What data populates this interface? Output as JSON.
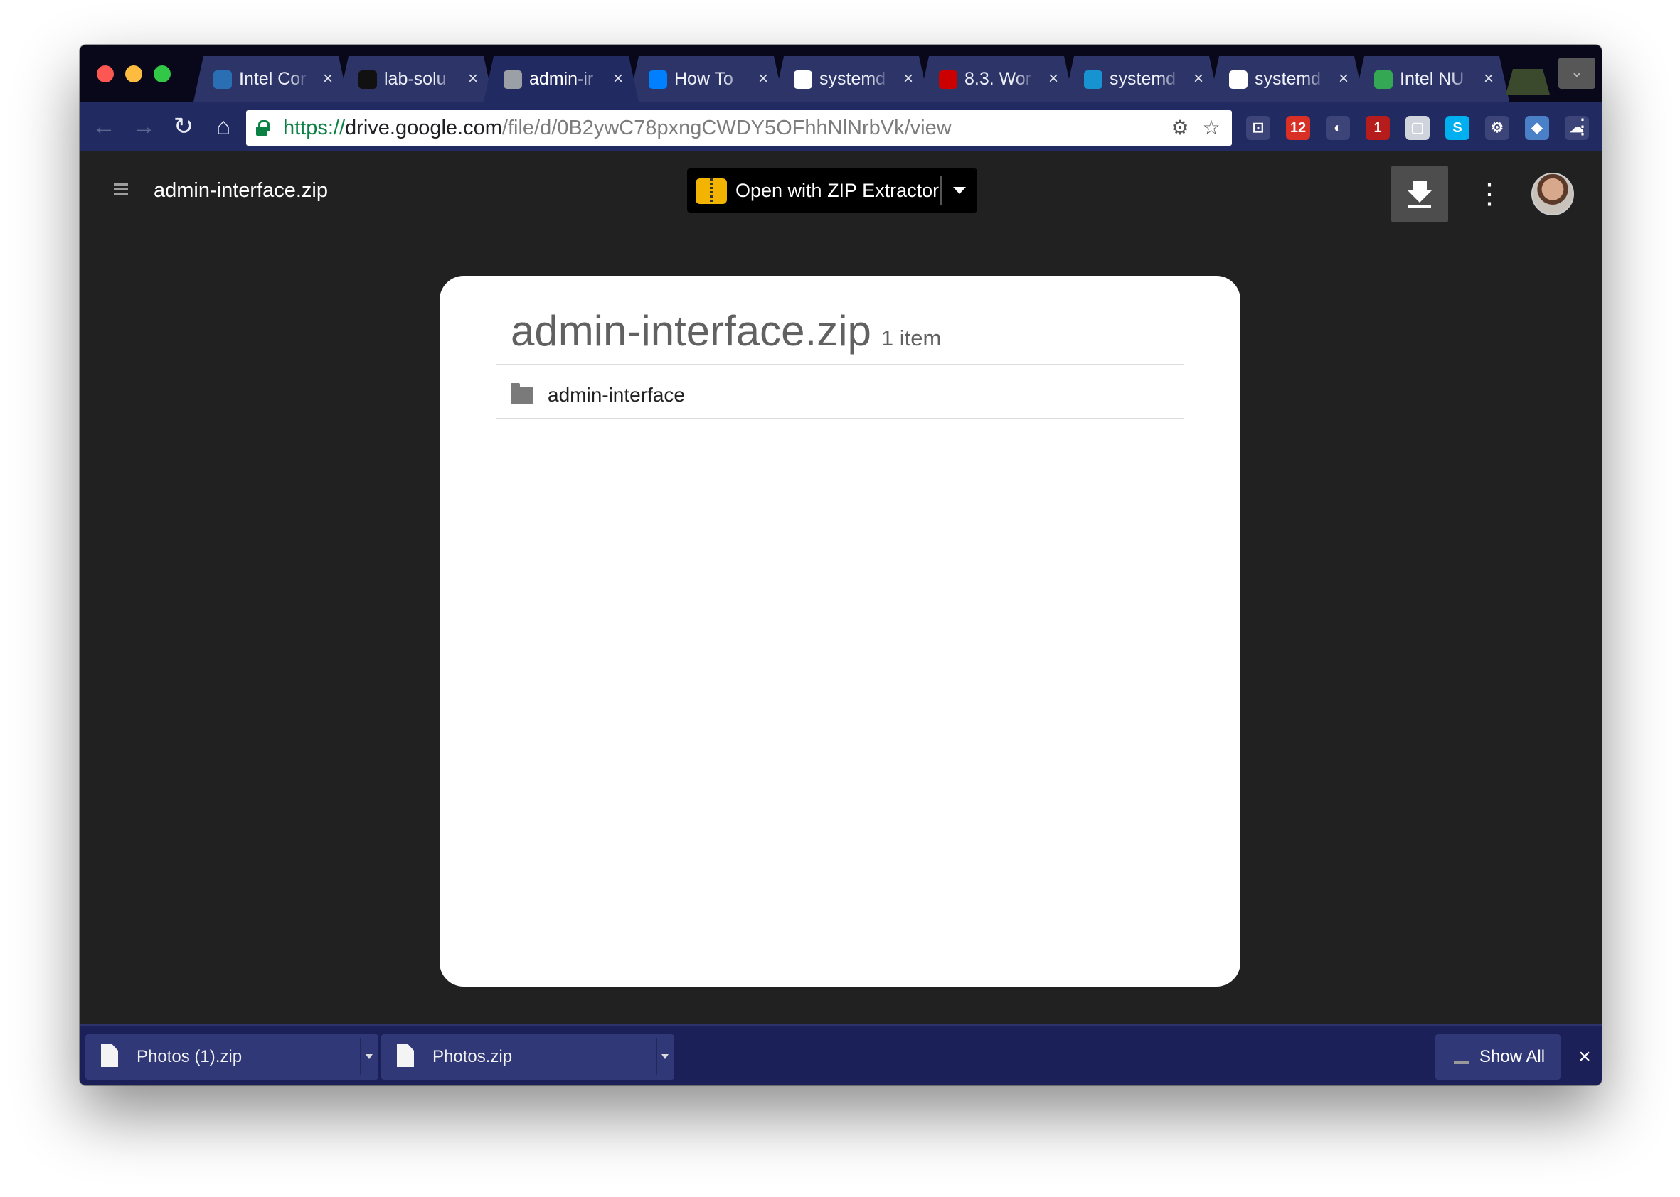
{
  "browser": {
    "tabs": [
      {
        "title": "Intel Cor",
        "close": "×",
        "favicon": "intel-icon",
        "color": "#2a6fb3"
      },
      {
        "title": "lab-solu",
        "close": "×",
        "favicon": "github-icon",
        "color": "#111111"
      },
      {
        "title": "admin-ir",
        "close": "×",
        "favicon": "drive-file-icon",
        "color": "#9aa0a6",
        "active": true
      },
      {
        "title": "How To",
        "close": "×",
        "favicon": "digitalocean-icon",
        "color": "#0080ff"
      },
      {
        "title": "systemd",
        "close": "×",
        "favicon": "google-icon",
        "color": "#ffffff"
      },
      {
        "title": "8.3. Wor",
        "close": "×",
        "favicon": "redhat-icon",
        "color": "#cc0000"
      },
      {
        "title": "systemd",
        "close": "×",
        "favicon": "archlinux-icon",
        "color": "#1793d1"
      },
      {
        "title": "systemd",
        "close": "×",
        "favicon": "document-icon",
        "color": "#ffffff"
      },
      {
        "title": "Intel NU",
        "close": "×",
        "favicon": "google-drive-icon",
        "color": "#34a853"
      }
    ],
    "nav": {
      "back": "←",
      "forward": "→",
      "reload": "↻",
      "home": "⌂"
    },
    "url": {
      "scheme": "https://",
      "domain": "drive.google.com",
      "path": "/file/d/0B2ywC78pxngCWDY5OFhhNlNrbVk/view"
    },
    "extensions": [
      {
        "name": "cast-icon",
        "glyph": "⊡",
        "color": "#3c4478"
      },
      {
        "name": "calendar-extension-icon",
        "glyph": "12",
        "color": "#d93025"
      },
      {
        "name": "dark-reader-icon",
        "glyph": "◐",
        "color": "#3c4478"
      },
      {
        "name": "ublock-icon",
        "glyph": "1",
        "color": "#b71c1c"
      },
      {
        "name": "notes-extension-icon",
        "glyph": "▢",
        "color": "#cfd3dc"
      },
      {
        "name": "skype-extension-icon",
        "glyph": "S",
        "color": "#00aff0"
      },
      {
        "name": "settings-extension-icon",
        "glyph": "⚙",
        "color": "#3c4478"
      },
      {
        "name": "pocket-extension-icon",
        "glyph": "◆",
        "color": "#4a80c8"
      },
      {
        "name": "cloud-extension-icon",
        "glyph": "☁",
        "color": "#3c4478"
      },
      {
        "name": "hangouts-extension-icon",
        "glyph": "❞",
        "color": "#0f9d58"
      }
    ],
    "menu": "⋮"
  },
  "drive": {
    "file_title": "admin-interface.zip",
    "open_with_label": "Open with ZIP Extractor",
    "more": "⋮"
  },
  "zip_view": {
    "title": "admin-interface.zip",
    "count": "1 item",
    "items": [
      {
        "name": "admin-interface",
        "type": "folder"
      }
    ]
  },
  "downloads": {
    "items": [
      {
        "name": "Photos (1).zip"
      },
      {
        "name": "Photos.zip"
      }
    ],
    "show_all": "Show All",
    "close": "×"
  }
}
